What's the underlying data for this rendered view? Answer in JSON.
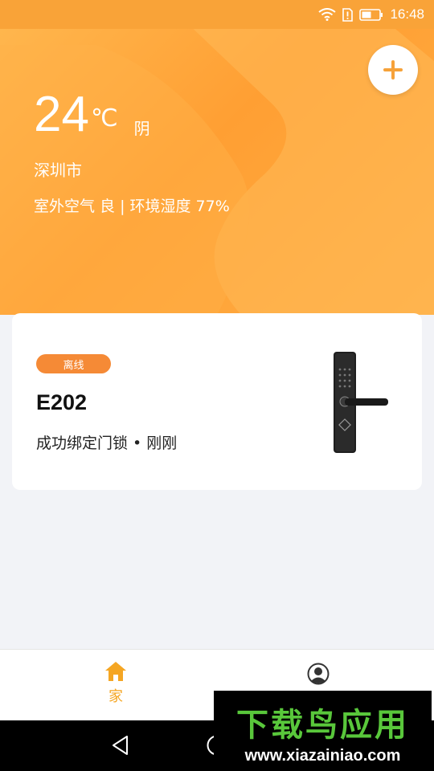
{
  "status_bar": {
    "time": "16:48",
    "icons": [
      "wifi-icon",
      "sim-alert-icon",
      "battery-icon"
    ]
  },
  "weather": {
    "temperature": "24",
    "unit": "℃",
    "condition": "阴",
    "city": "深圳市",
    "air_info": "室外空气 良 | 环境湿度 77%"
  },
  "device": {
    "status_badge": "离线",
    "name": "E202",
    "event": "成功绑定门锁 • 刚刚"
  },
  "bottom_nav": {
    "home_label": "家",
    "icons": [
      "home-icon",
      "profile-icon"
    ]
  },
  "system_nav": {
    "icons": [
      "back-icon",
      "home-circle-icon"
    ]
  },
  "watermark": {
    "title": "下载鸟应用",
    "url": "www.xiazainiao.com"
  },
  "colors": {
    "accent": "#f9a338",
    "badge": "#f58a36",
    "nav_active": "#f5a623",
    "watermark_green": "#59c73b"
  }
}
